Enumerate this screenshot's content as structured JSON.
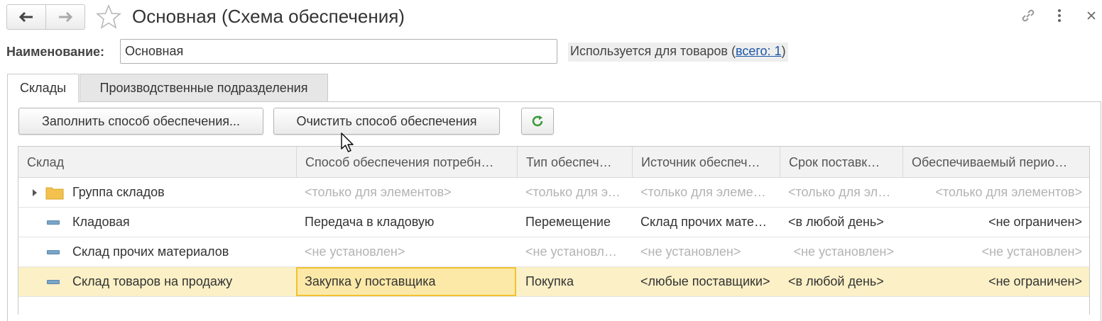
{
  "window": {
    "title": "Основная (Схема обеспечения)",
    "icons": [
      "back-arrow-icon",
      "forward-arrow-icon",
      "favorite-star-icon",
      "link-icon",
      "more-vertical-icon",
      "close-icon"
    ]
  },
  "name_row": {
    "label": "Наименование:",
    "value": "Основная",
    "used_for_prefix": "Используется для товаров (",
    "used_for_link": "всего: 1",
    "used_for_suffix": ")"
  },
  "tabs": [
    {
      "label": "Склады",
      "active": true
    },
    {
      "label": "Производственные подразделения",
      "active": false
    }
  ],
  "toolbar": {
    "fill_label": "Заполнить способ обеспечения...",
    "clear_label": "Очистить способ обеспечения",
    "refresh_icon": "refresh-icon"
  },
  "table": {
    "columns": [
      "Склад",
      "Способ обеспечения потребн…",
      "Тип обеспеч…",
      "Источник обеспеч…",
      "Срок поставк…",
      "Обеспечиваемый перио…"
    ],
    "rows": [
      {
        "warehouse": "Группа складов",
        "method": "<только для элементов>",
        "type": "<только для элементов>",
        "source": "<только для элементов>",
        "term": "<только для элементов>",
        "period": "<только для элементов>"
      },
      {
        "warehouse": "Кладовая",
        "method": "Передача в кладовую",
        "type": "Перемещение",
        "source": "Склад прочих материалов",
        "term": "<в любой день>",
        "period": "<не ограничен>"
      },
      {
        "warehouse": "Склад прочих материалов",
        "method": "<не установлен>",
        "type": "<не установлен>",
        "source": "<не установлен>",
        "term": "<не установлен>",
        "period": "<не установлен>"
      },
      {
        "warehouse": "Склад товаров на продажу",
        "method": "Закупка у поставщика",
        "type": "Покупка",
        "source": "<любые поставщики>",
        "term": "<в любой день>",
        "period": "<не ограничен>"
      }
    ]
  },
  "colors": {
    "accent_green": "#3a9a3a",
    "folder": "#f2c14e",
    "selected_row": "#fbf0c6",
    "focus_border": "#f2c230",
    "link": "#1a56a8"
  }
}
